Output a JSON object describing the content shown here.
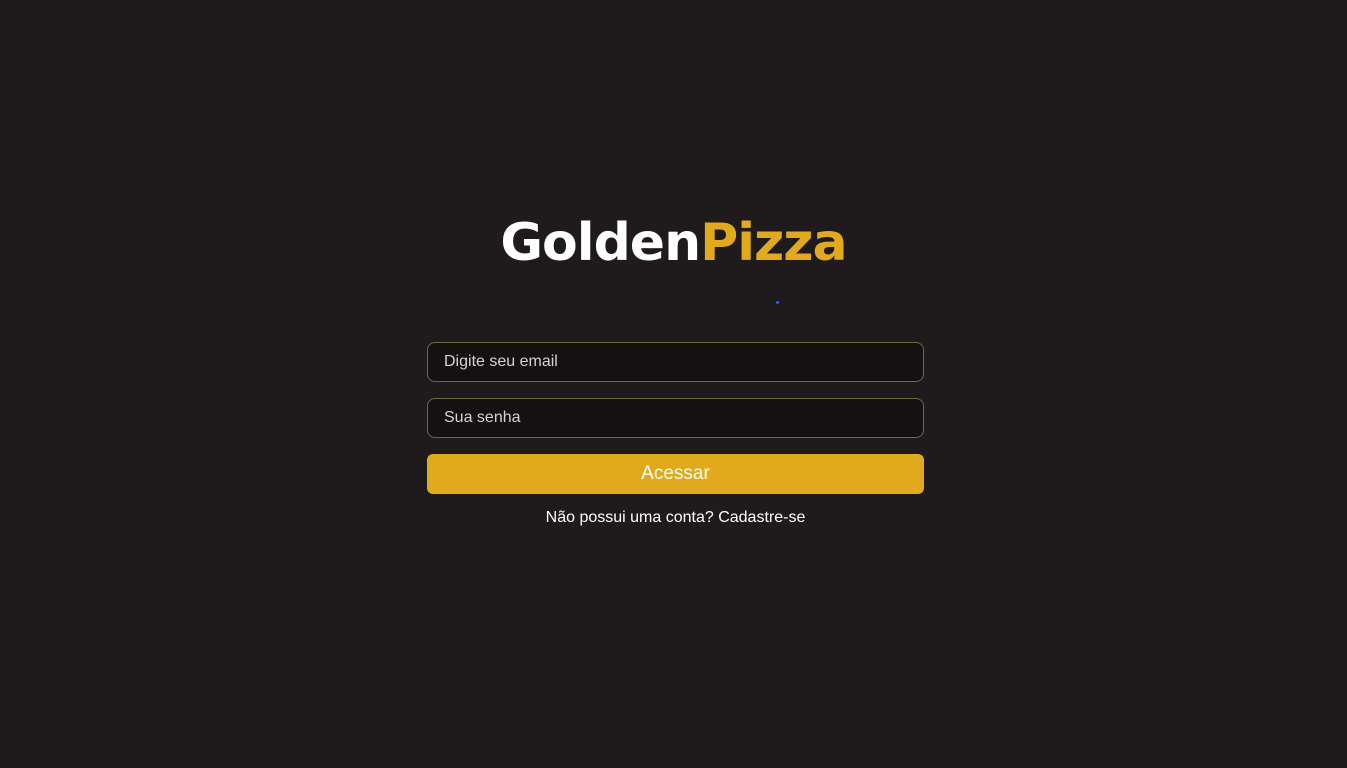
{
  "brand": {
    "part1": "Golden",
    "part2": "Pizza",
    "primary_color": "#ffffff",
    "accent_color": "#e0a91e"
  },
  "login_form": {
    "email_placeholder": "Digite seu email",
    "password_placeholder": "Sua senha",
    "submit_label": "Acessar",
    "signup_text": "Não possui uma conta?",
    "signup_link": "Cadastre-se"
  },
  "colors": {
    "background": "#1f1b1c",
    "input_background": "#141112",
    "input_border": "#6b6a3a",
    "button": "#e1aa1d"
  }
}
